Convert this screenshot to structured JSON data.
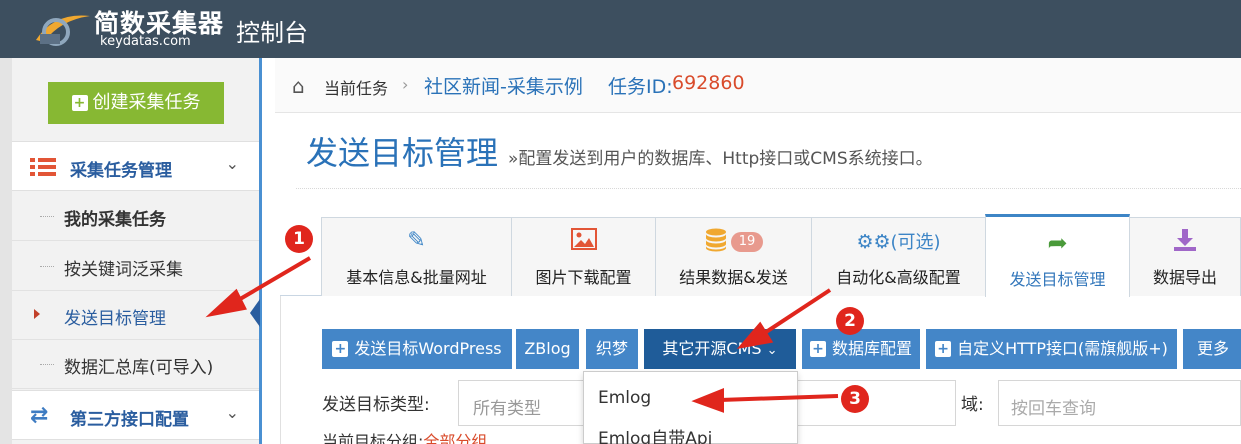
{
  "header": {
    "logo_name": "简数采集器",
    "logo_domain": "keydatas.com",
    "app_title": "控制台"
  },
  "sidebar": {
    "create_button": "创建采集任务",
    "group1": {
      "label": "采集任务管理",
      "icon": "list-icon"
    },
    "items": [
      {
        "label": "我的采集任务"
      },
      {
        "label": "按关键词泛采集"
      },
      {
        "label": "发送目标管理"
      },
      {
        "label": "数据汇总库(可导入)"
      }
    ],
    "group2": {
      "label": "第三方接口配置",
      "icon": "swap-icon"
    }
  },
  "breadcrumb": {
    "current_label": "当前任务",
    "task_name": "社区新闻-采集示例",
    "task_id_label": "任务ID:",
    "task_id": "692860"
  },
  "page": {
    "title": "发送目标管理",
    "subtitle": "»配置发送到用户的数据库、Http接口或CMS系统接口。"
  },
  "tabs": [
    {
      "label": "基本信息&批量网址",
      "icon": "edit-icon"
    },
    {
      "label": "图片下载配置",
      "icon": "image-icon"
    },
    {
      "label": "结果数据&发送",
      "icon": "database-icon",
      "badge": "19"
    },
    {
      "label": "自动化&高级配置",
      "icon": "gears-icon",
      "icon_text": "(可选)"
    },
    {
      "label": "发送目标管理",
      "icon": "share-icon",
      "active": true
    },
    {
      "label": "数据导出",
      "icon": "download-icon"
    }
  ],
  "toolbar": {
    "wordpress": "发送目标WordPress",
    "zblog": "ZBlog",
    "dedecms": "织梦",
    "other_cms": "其它开源CMS",
    "db_config": "数据库配置",
    "http": "自定义HTTP接口(需旗舰版+)",
    "more": "更多"
  },
  "filters": {
    "type_label": "发送目标类型:",
    "type_placeholder": "所有类型",
    "domain_label": "域:",
    "domain_placeholder": "按回车查询",
    "group_label": "当前目标分组:",
    "group_value": "全部分组"
  },
  "dropdown": {
    "items": [
      "Emlog",
      "Emlog自带Api"
    ]
  },
  "annotations": [
    "1",
    "2",
    "3"
  ],
  "colors": {
    "accent": "#2a72b8",
    "button": "#4486c8",
    "button_dark": "#1f5c99",
    "create": "#87b833",
    "annotation": "#e0261d"
  }
}
